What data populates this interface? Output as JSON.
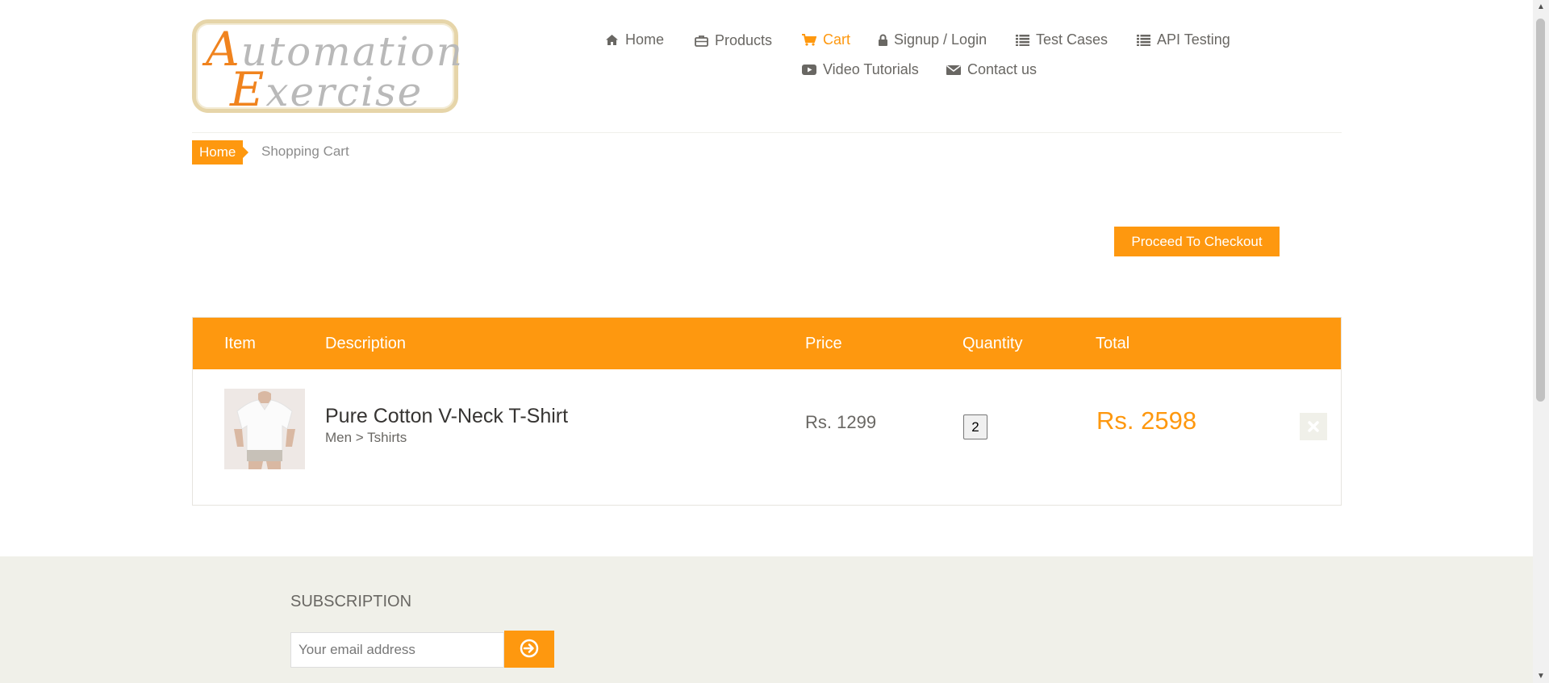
{
  "logo": {
    "line1_cap": "A",
    "line1_rest": "utomation",
    "line2_cap": "E",
    "line2_rest": "xercise"
  },
  "nav": {
    "items": [
      {
        "label": "Home",
        "icon": "home-icon"
      },
      {
        "label": "Products",
        "icon": "briefcase-icon"
      },
      {
        "label": "Cart",
        "icon": "cart-icon",
        "active": true
      },
      {
        "label": "Signup / Login",
        "icon": "lock-icon"
      },
      {
        "label": "Test Cases",
        "icon": "list-icon"
      },
      {
        "label": "API Testing",
        "icon": "list-icon"
      },
      {
        "label": "Video Tutorials",
        "icon": "youtube-play-icon"
      },
      {
        "label": "Contact us",
        "icon": "envelope-icon"
      }
    ]
  },
  "breadcrumb": {
    "home": "Home",
    "current": "Shopping Cart"
  },
  "checkout": {
    "label": "Proceed To Checkout"
  },
  "cart": {
    "headers": [
      "Item",
      "Description",
      "Price",
      "Quantity",
      "Total"
    ],
    "rows": [
      {
        "name": "Pure Cotton V-Neck T-Shirt",
        "category": "Men > Tshirts",
        "price": "Rs. 1299",
        "quantity": "2",
        "total": "Rs. 2598"
      }
    ]
  },
  "footer": {
    "subscription_title": "SUBSCRIPTION",
    "email_placeholder": "Your email address"
  },
  "colors": {
    "accent": "#fe980f",
    "text": "#696763",
    "footer_bg": "#f0f0e9"
  }
}
